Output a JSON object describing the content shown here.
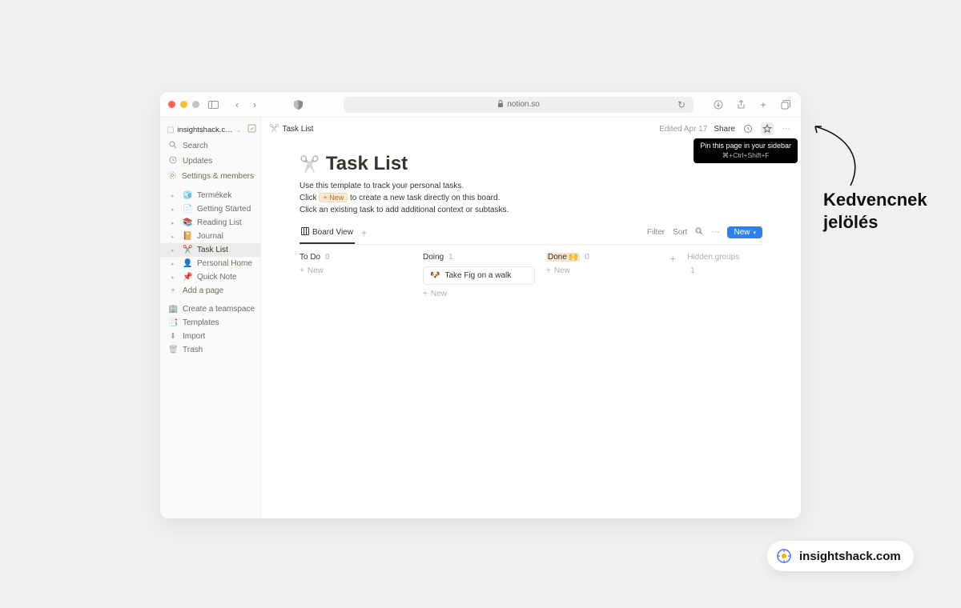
{
  "browser": {
    "url_host": "notion.so"
  },
  "workspace": {
    "name": "insightshack.c…"
  },
  "sidebar": {
    "search": "Search",
    "updates": "Updates",
    "settings": "Settings & members",
    "pages": [
      {
        "icon": "🧊",
        "label": "Termékek"
      },
      {
        "icon": "📄",
        "label": "Getting Started"
      },
      {
        "icon": "📚",
        "label": "Reading List"
      },
      {
        "icon": "📔",
        "label": "Journal"
      },
      {
        "icon": "✂️",
        "label": "Task List",
        "selected": true
      },
      {
        "icon": "👤",
        "label": "Personal Home"
      },
      {
        "icon": "📌",
        "label": "Quick Note"
      }
    ],
    "add_page": "Add a page",
    "footer": [
      {
        "icon": "🏢",
        "label": "Create a teamspace"
      },
      {
        "icon": "📑",
        "label": "Templates"
      },
      {
        "icon": "⬇",
        "label": "Import"
      },
      {
        "icon": "🗑",
        "label": "Trash"
      }
    ]
  },
  "topbar": {
    "breadcrumb_icon": "✂️",
    "breadcrumb": "Task List",
    "edited": "Edited Apr 17",
    "share": "Share",
    "tooltip_title": "Pin this page in your sidebar",
    "tooltip_kbd": "⌘+Ctrl+Shift+F"
  },
  "page": {
    "icon": "✂️",
    "title": "Task List",
    "desc_line1": "Use this template to track your personal tasks.",
    "desc_line2a": "Click ",
    "desc_line2_tag": "+ New",
    "desc_line2b": " to create a new task directly on this board.",
    "desc_line3": "Click an existing task to add additional context or subtasks."
  },
  "views": {
    "active": "Board View",
    "toolbar": {
      "filter": "Filter",
      "sort": "Sort",
      "new": "New"
    }
  },
  "board": {
    "columns": [
      {
        "name": "To Do",
        "count": 0,
        "cards": []
      },
      {
        "name": "Doing",
        "count": 1,
        "cards": [
          {
            "icon": "🐶",
            "title": "Take Fig on a walk"
          }
        ]
      },
      {
        "name": "Done",
        "emoji": "🙌",
        "count": 0,
        "cards": []
      }
    ],
    "new_label": "New",
    "hidden_label": "Hidden groups",
    "hidden_count": 1
  },
  "annotation": {
    "label_line1": "Kedvencnek",
    "label_line2": "jelölés"
  },
  "badge": {
    "text": "insightshack.com"
  }
}
